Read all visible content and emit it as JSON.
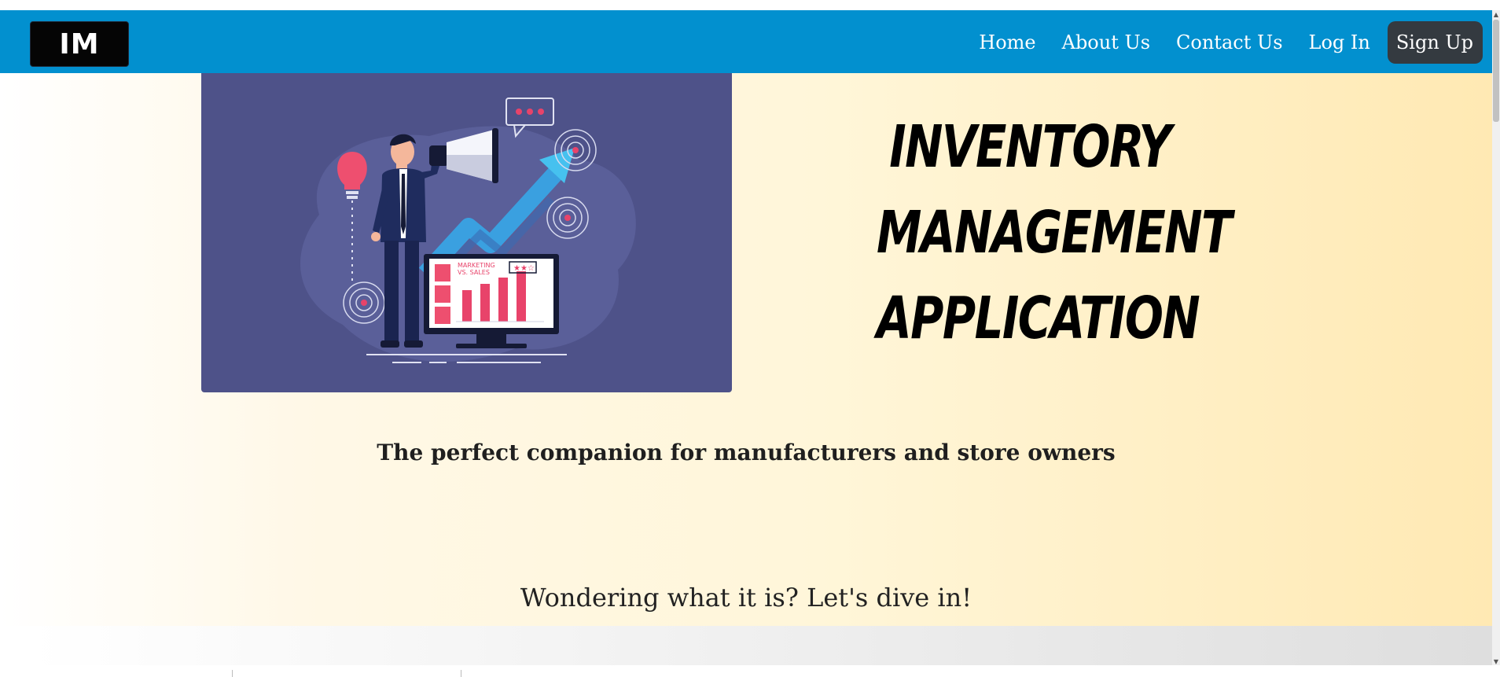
{
  "navbar": {
    "logo_text": "IM",
    "links": [
      "Home",
      "About Us",
      "Contact Us",
      "Log In"
    ],
    "signup_label": "Sign Up",
    "background_color": "#0290cf",
    "signup_color": "#343a40"
  },
  "hero": {
    "headline_lines": [
      "INVENTORY",
      "MANAGEMENT",
      "APPLICATION"
    ],
    "illustration_text": {
      "marketing": "MARKETING",
      "vs_sales": "VS. SALES"
    },
    "tagline": "The perfect companion for manufacturers and store owners",
    "cta_text": "Wondering what it is? Let's dive in!"
  },
  "icons": [
    "megaphone-icon",
    "lightbulb-icon",
    "speech-bubble-icon",
    "target-icon",
    "trend-arrow-icon",
    "monitor-chart-icon"
  ]
}
